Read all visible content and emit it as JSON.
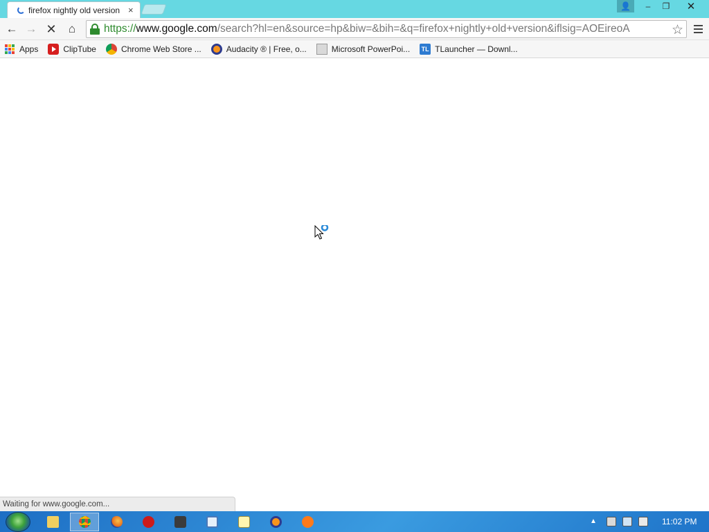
{
  "tab": {
    "title": "firefox nightly old version",
    "close_glyph": "×"
  },
  "window": {
    "minimize_glyph": "–",
    "maximize_glyph": "❐",
    "close_glyph": "✕",
    "user_glyph": "👤"
  },
  "toolbar": {
    "back_glyph": "←",
    "forward_glyph": "→",
    "stop_glyph": "✕",
    "home_glyph": "⌂",
    "url_scheme": "https://",
    "url_host": "www.google.com",
    "url_path": "/search?hl=en&source=hp&biw=&bih=&q=firefox+nightly+old+version&iflsig=AOEireoA",
    "star_glyph": "☆"
  },
  "bookmarks": [
    {
      "label": "Apps",
      "icon": "apps-grid-icon"
    },
    {
      "label": "ClipTube",
      "icon": "cliptube-icon"
    },
    {
      "label": "Chrome Web Store ...",
      "icon": "chrome-web-store-icon"
    },
    {
      "label": "Audacity ® | Free, o...",
      "icon": "audacity-icon"
    },
    {
      "label": "Microsoft PowerPoi...",
      "icon": "powerpoint-icon"
    },
    {
      "label": "TLauncher — Downl...",
      "icon": "tlauncher-icon",
      "icon_text": "TL"
    }
  ],
  "status_text": "Waiting for www.google.com...",
  "taskbar": {
    "items": [
      {
        "name": "file-explorer",
        "icon": "folder-icon"
      },
      {
        "name": "chrome",
        "icon": "chrome-icon",
        "active": true
      },
      {
        "name": "firefox",
        "icon": "firefox-icon"
      },
      {
        "name": "opera",
        "icon": "opera-icon"
      },
      {
        "name": "minecraft",
        "icon": "minecraft-icon"
      },
      {
        "name": "remote-desktop",
        "icon": "remote-desktop-icon"
      },
      {
        "name": "notes",
        "icon": "notes-icon"
      },
      {
        "name": "audacity",
        "icon": "audacity-icon"
      },
      {
        "name": "avast",
        "icon": "avast-icon"
      }
    ],
    "clock": "11:02 PM",
    "tray_arrow": "▲"
  },
  "colors": {
    "titlebar": "#66d8e2",
    "secure_green": "#2e8b2e",
    "taskbar": "#2a86d6"
  }
}
